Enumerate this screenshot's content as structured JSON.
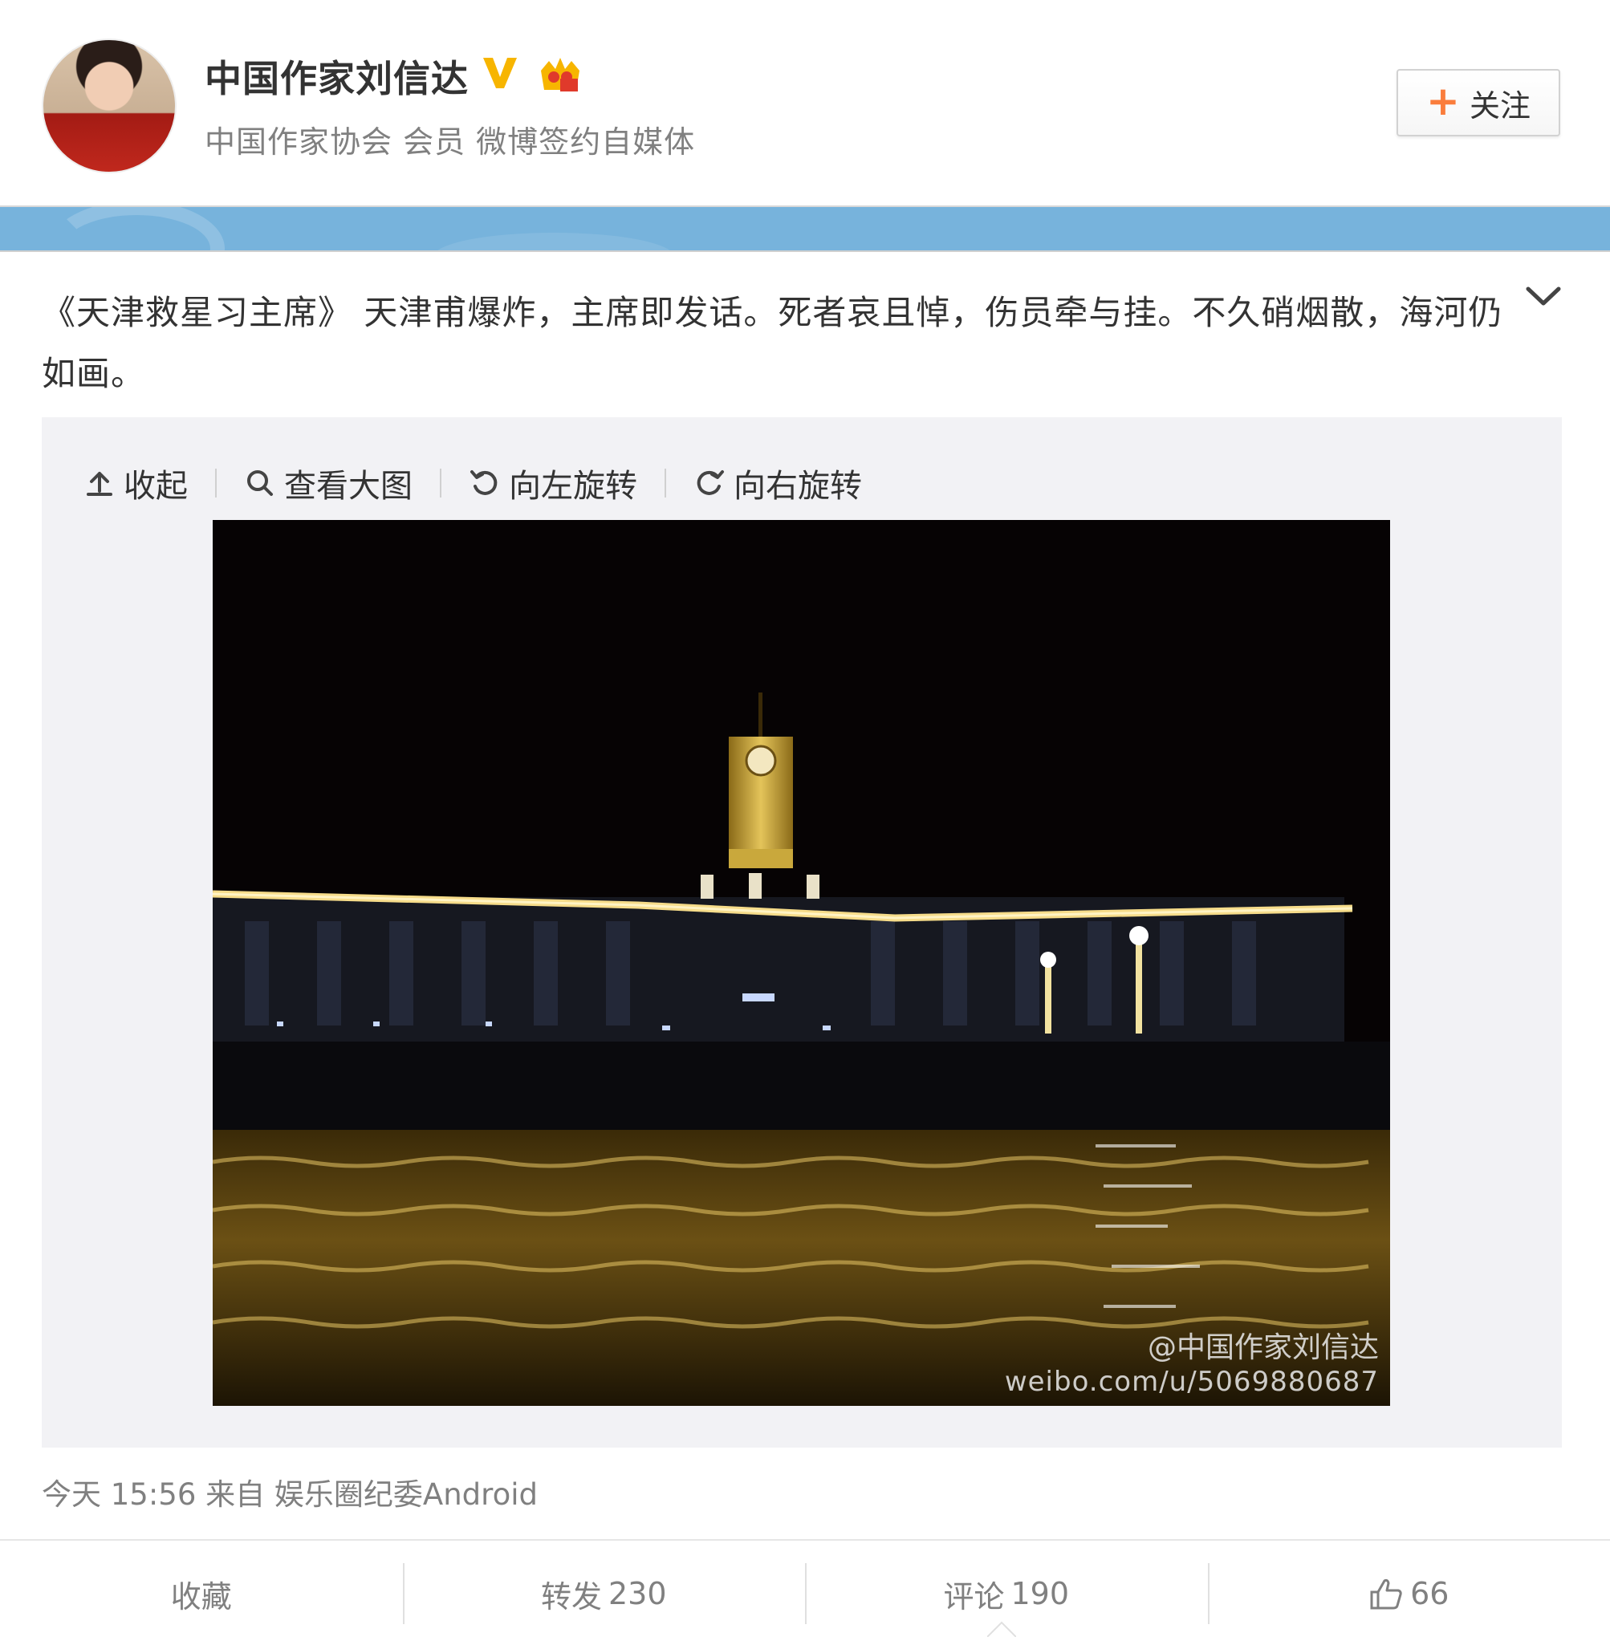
{
  "header": {
    "user_name": "中国作家刘信达",
    "user_desc": "中国作家协会 会员 微博签约自媒体",
    "follow_plus": "+",
    "follow_label": "关注",
    "verified_color": "#f7b500",
    "vip_color": "#f7b500"
  },
  "post": {
    "text": "《天津救星习主席》 天津甫爆炸，主席即发话。死者哀且悼，伤员牵与挂。不久硝烟散，海河仍如画。",
    "toolbar": {
      "collapse": "收起",
      "view_large": "查看大图",
      "rotate_left": "向左旋转",
      "rotate_right": "向右旋转"
    },
    "watermark": {
      "name": "@中国作家刘信达",
      "url": "weibo.com/u/5069880687"
    },
    "meta": {
      "time": "今天 15:56",
      "from_label": "来自",
      "source": "娱乐圈纪委Android"
    }
  },
  "actions": {
    "favorite": "收藏",
    "repost_label": "转发",
    "repost_count": "230",
    "comment_label": "评论",
    "comment_count": "190",
    "like_count": "66"
  },
  "colors": {
    "page_bg": "#77b3dc",
    "accent_orange": "#fa7d3c",
    "muted_text": "#808080"
  }
}
